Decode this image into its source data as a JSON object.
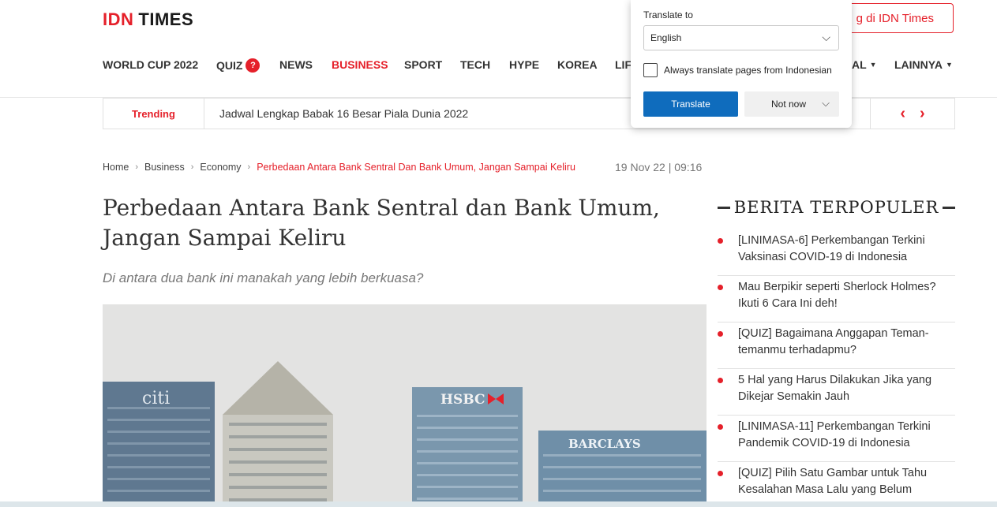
{
  "logo": {
    "idn": "IDN",
    "times": "TIMES"
  },
  "login_button": "g di IDN Times",
  "nav": [
    {
      "label": "WORLD CUP 2022",
      "active": false
    },
    {
      "label": "QUIZ",
      "active": false,
      "badge": "?"
    },
    {
      "label": "NEWS",
      "active": false
    },
    {
      "label": "BUSINESS",
      "active": true
    },
    {
      "label": "SPORT",
      "active": false
    },
    {
      "label": "TECH",
      "active": false
    },
    {
      "label": "HYPE",
      "active": false
    },
    {
      "label": "KOREA",
      "active": false
    },
    {
      "label": "LIF",
      "active": false
    },
    {
      "label": "AL",
      "active": false,
      "dropdown": true
    },
    {
      "label": "LAINNYA",
      "active": false,
      "dropdown": true
    }
  ],
  "trending": {
    "label": "Trending",
    "headline": "Jadwal Lengkap Babak 16 Besar Piala Dunia 2022",
    "prev": "‹",
    "next": "›"
  },
  "breadcrumb": {
    "items": [
      "Home",
      "Business",
      "Economy"
    ],
    "current": "Perbedaan Antara Bank Sentral Dan Bank Umum, Jangan Sampai Keliru",
    "separator": "›"
  },
  "date": "19 Nov 22 | 09:16",
  "article": {
    "title": "Perbedaan Antara Bank Sentral dan Bank Umum, Jangan Sampai Keliru",
    "subtitle": "Di antara dua bank ini manakah yang lebih berkuasa?",
    "image_signs": {
      "citi": "citi",
      "hsbc": "HSBC",
      "barclays": "BARCLAYS"
    }
  },
  "popular": {
    "title": "BERITA TERPOPULER",
    "items": [
      "[LINIMASA-6] Perkembangan Terkini Vaksinasi COVID-19 di Indonesia",
      "Mau Berpikir seperti Sherlock Holmes? Ikuti 6 Cara Ini deh!",
      "[QUIZ] Bagaimana Anggapan Teman-temanmu terhadapmu?",
      "5 Hal yang Harus Dilakukan Jika yang Dikejar Semakin Jauh",
      "[LINIMASA-11] Perkembangan Terkini Pandemik COVID-19 di Indonesia",
      "[QUIZ] Pilih Satu Gambar untuk Tahu Kesalahan Masa Lalu yang Belum"
    ]
  },
  "translate_popup": {
    "label": "Translate to",
    "selected_language": "English",
    "checkbox_label": "Always translate pages from Indonesian",
    "translate_button": "Translate",
    "not_now_button": "Not now"
  },
  "colors": {
    "brand_red": "#e5202a",
    "translate_blue": "#0f6cbd"
  }
}
